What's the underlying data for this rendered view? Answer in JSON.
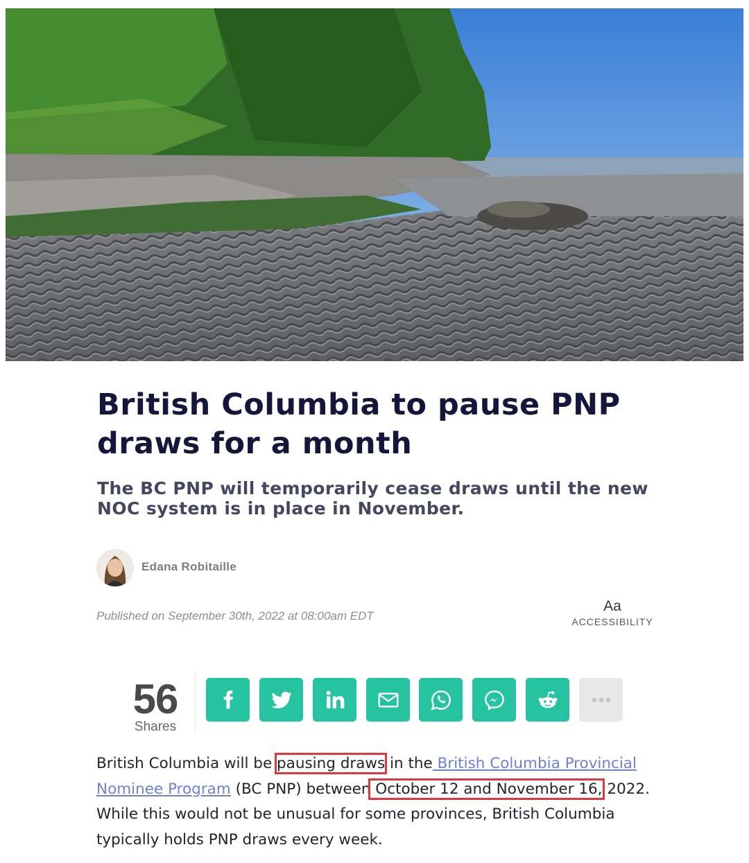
{
  "article": {
    "title": "British Columbia to pause PNP draws for a month",
    "subtitle": "The BC PNP will temporarily cease draws until the new NOC system is in place in November.",
    "author": "Edana Robitaille",
    "published": "Published on September 30th, 2022 at 08:00am EDT"
  },
  "accessibility": {
    "icon_text": "Aa",
    "label": "ACCESSIBILITY"
  },
  "shares": {
    "count": "56",
    "label": "Shares",
    "buttons": [
      {
        "name": "facebook",
        "icon": "facebook-icon"
      },
      {
        "name": "twitter",
        "icon": "twitter-icon"
      },
      {
        "name": "linkedin",
        "icon": "linkedin-icon"
      },
      {
        "name": "email",
        "icon": "envelope-icon"
      },
      {
        "name": "whatsapp",
        "icon": "whatsapp-icon"
      },
      {
        "name": "messenger",
        "icon": "messenger-icon"
      },
      {
        "name": "reddit",
        "icon": "reddit-icon"
      },
      {
        "name": "more",
        "icon": "more-dots-icon"
      }
    ],
    "accent_color": "#25c3a0"
  },
  "body": {
    "p1_a": "British Columbia will be",
    "p1_highlight1": "pausing draws",
    "p1_b": "in the",
    "p1_link": " British Columbia Provincial Nominee Program",
    "p1_c": " (BC PNP) between",
    "p1_highlight2": " October 12 and November 16,",
    "p1_d": " 2022. While this would not be unusual for some provinces, British Columbia typically holds PNP draws every week.",
    "highlight_color": "#e0363d",
    "link_color": "#6e7fd8"
  }
}
